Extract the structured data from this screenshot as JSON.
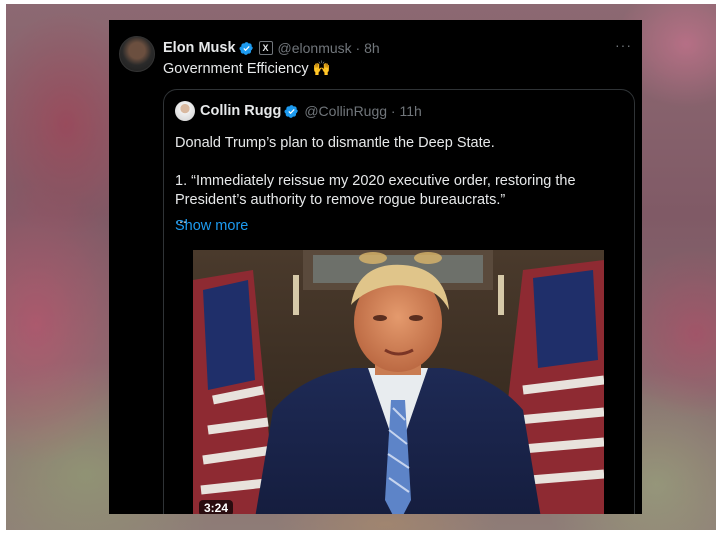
{
  "author": {
    "name": "Elon Musk",
    "handle": "@elonmusk",
    "time": "8h",
    "affiliate_badge": "X"
  },
  "tweet_text": "Government Efficiency 🙌",
  "more_icon": "···",
  "quote": {
    "name": "Collin Rugg",
    "handle": "@CollinRugg",
    "time": "11h",
    "line1": "Donald Trump’s plan to dismantle the Deep State.",
    "line2": "1. “Immediately reissue my 2020 executive order, restoring the\nPresident’s authority to remove rogue bureaucrats.”",
    "ellipsis": "...",
    "show_more": "Show more",
    "video_duration": "3:24"
  },
  "colors": {
    "background": "#000000",
    "text": "#e7e9ea",
    "secondary": "#71767b",
    "link": "#1d9bf0",
    "verified": "#1d9bf0"
  },
  "icons": [
    "verified-badge-icon",
    "x-affiliate-icon",
    "more-options-icon",
    "raising-hands-emoji"
  ]
}
